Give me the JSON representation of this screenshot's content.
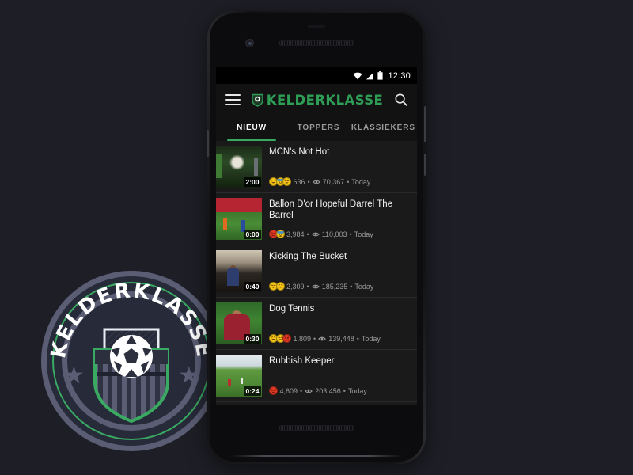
{
  "brand": {
    "name": "KELDERKLASSE",
    "badge_text": "KELDERKLASSE",
    "green": "#3aaa63",
    "slate": "#5a5d74",
    "dark": "#272a38"
  },
  "phone": {
    "status_bar": {
      "time": "12:30",
      "icons": [
        "wifi-icon",
        "signal-icon",
        "battery-icon"
      ]
    },
    "app_bar": {
      "menu_label": "hamburger-menu",
      "title": "KELDERKLASSE",
      "search_label": "search"
    },
    "tabs": [
      {
        "label": "NIEUW",
        "active": true
      },
      {
        "label": "TOPPERS",
        "active": false
      },
      {
        "label": "KLASSIEKERS",
        "active": false
      }
    ],
    "videos": [
      {
        "title": "MCN's Not Hot",
        "duration": "2:00",
        "reactions": 636,
        "reactions_text": "636",
        "views_text": "70,367",
        "date": "Today",
        "emojis": [
          "laughing-emoji",
          "cold-face-emoji",
          "smiling-hearts-emoji"
        ],
        "emoji_colors": [
          "#f5c518",
          "#f5c518",
          "#f5c518"
        ]
      },
      {
        "title": "Ballon D'or Hopeful Darrel The Barrel",
        "duration": "0:00",
        "reactions": 3984,
        "reactions_text": "3,984",
        "views_text": "110,003",
        "date": "Today",
        "emojis": [
          "angry-emoji",
          "cold-face-emoji"
        ],
        "emoji_colors": [
          "#e03a25",
          "#f5c518"
        ]
      },
      {
        "title": "Kicking The Bucket",
        "duration": "0:40",
        "reactions": 2309,
        "reactions_text": "2,309",
        "views_text": "185,235",
        "date": "Today",
        "emojis": [
          "smiling-hearts-emoji",
          "laughing-emoji"
        ],
        "emoji_colors": [
          "#f5c518",
          "#f5c518"
        ]
      },
      {
        "title": "Dog Tennis",
        "duration": "0:30",
        "reactions": 1809,
        "reactions_text": "1,809",
        "views_text": "139,448",
        "date": "Today",
        "emojis": [
          "laughing-emoji",
          "smiling-hearts-emoji",
          "angry-emoji"
        ],
        "emoji_colors": [
          "#f5c518",
          "#f5c518",
          "#e03a25"
        ]
      },
      {
        "title": "Rubbish Keeper",
        "duration": "0:24",
        "reactions": 4609,
        "reactions_text": "4,609",
        "views_text": "203,456",
        "date": "Today",
        "emojis": [
          "angry-emoji"
        ],
        "emoji_colors": [
          "#e03a25"
        ]
      }
    ],
    "meta_separator": "•"
  }
}
